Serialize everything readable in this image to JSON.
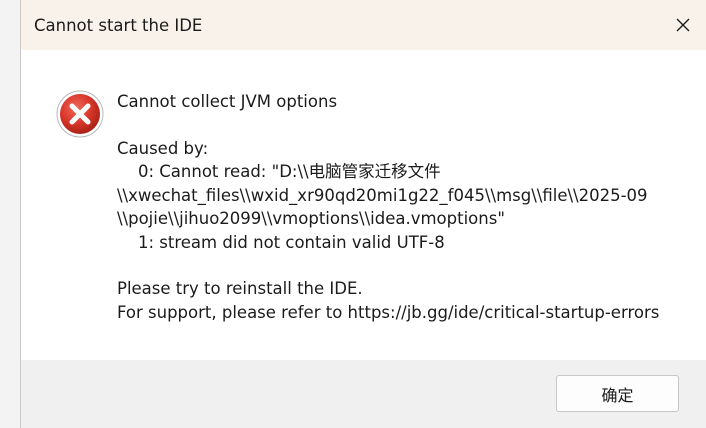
{
  "dialog": {
    "title": "Cannot start the IDE",
    "close_icon": "close-icon",
    "error_icon": "error-icon",
    "heading": "Cannot collect JVM options",
    "caused_by_label": "Caused by:",
    "cause_lines": [
      "    0: Cannot read: \"D:\\\\电脑管家迁移文件",
      "\\\\xwechat_files\\\\wxid_xr90qd20mi1g22_f045\\\\msg\\\\file\\\\2025-09",
      "\\\\pojie\\\\jihuo2099\\\\vmoptions\\\\idea.vmoptions\"",
      "    1: stream did not contain valid UTF-8"
    ],
    "advice": "Please try to reinstall the IDE.",
    "support": "For support, please refer to https://jb.gg/ide/critical-startup-errors",
    "ok_label": "确定"
  },
  "colors": {
    "titlebar_bg": "#f9f2ea",
    "footer_bg": "#f0f0f0",
    "error_red": "#c42b1c"
  }
}
